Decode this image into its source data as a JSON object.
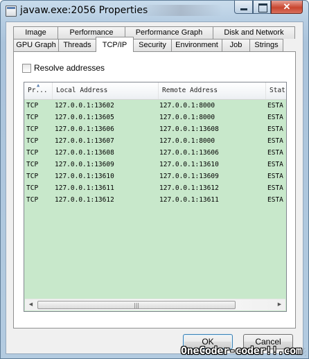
{
  "window": {
    "title": "javaw.exe:2056 Properties"
  },
  "tabs_row1": [
    {
      "label": "Image"
    },
    {
      "label": "Performance"
    },
    {
      "label": "Performance Graph"
    },
    {
      "label": "Disk and Network"
    }
  ],
  "tabs_row2": [
    {
      "label": "GPU Graph"
    },
    {
      "label": "Threads"
    },
    {
      "label": "TCP/IP",
      "active": true
    },
    {
      "label": "Security"
    },
    {
      "label": "Environment"
    },
    {
      "label": "Job"
    },
    {
      "label": "Strings"
    }
  ],
  "resolve": {
    "label": "Resolve addresses",
    "checked": false
  },
  "table": {
    "columns": [
      "Pr...",
      "Local Address",
      "Remote Address",
      "Stat"
    ],
    "rows": [
      [
        "TCP",
        "127.0.0.1:13602",
        "127.0.0.1:8000",
        "ESTA"
      ],
      [
        "TCP",
        "127.0.0.1:13605",
        "127.0.0.1:8000",
        "ESTA"
      ],
      [
        "TCP",
        "127.0.0.1:13606",
        "127.0.0.1:13608",
        "ESTA"
      ],
      [
        "TCP",
        "127.0.0.1:13607",
        "127.0.0.1:8000",
        "ESTA"
      ],
      [
        "TCP",
        "127.0.0.1:13608",
        "127.0.0.1:13606",
        "ESTA"
      ],
      [
        "TCP",
        "127.0.0.1:13609",
        "127.0.0.1:13610",
        "ESTA"
      ],
      [
        "TCP",
        "127.0.0.1:13610",
        "127.0.0.1:13609",
        "ESTA"
      ],
      [
        "TCP",
        "127.0.0.1:13611",
        "127.0.0.1:13612",
        "ESTA"
      ],
      [
        "TCP",
        "127.0.0.1:13612",
        "127.0.0.1:13611",
        "ESTA"
      ]
    ]
  },
  "buttons": {
    "ok": "OK",
    "cancel": "Cancel"
  },
  "watermark": "OneCoder-coder!!.com",
  "colors": {
    "row_background": "#c8e8cb",
    "title_gradient_top": "#c9dcec",
    "close_button": "#c9462f",
    "default_button_border": "#3c7fb1"
  }
}
